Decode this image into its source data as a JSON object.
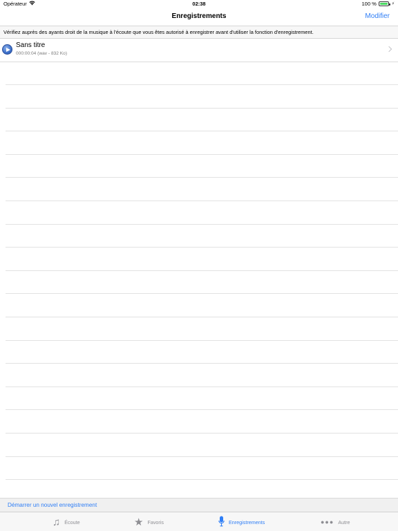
{
  "status_bar": {
    "carrier": "Opérateur",
    "wifi_icon": "wifi-icon",
    "time": "02:38",
    "battery": "100 %",
    "battery_icon": "battery-icon"
  },
  "nav": {
    "title": "Enregistrements",
    "edit_label": "Modifier"
  },
  "notice": "Vérifiez auprès des ayants droit de la musique à l'écoute que vous êtes autorisé à enregistrer avant d'utiliser la fonction d'enregistrement.",
  "recordings": [
    {
      "title": "Sans titre",
      "details": "000:00:04 (wav - 832 Ko)"
    }
  ],
  "footer": {
    "new_recording_label": "Démarrer un nouvel enregistrement"
  },
  "tabs": [
    {
      "label": "Écoute",
      "icon": "music-note-icon"
    },
    {
      "label": "Favoris",
      "icon": "star-icon"
    },
    {
      "label": "Enregistrements",
      "icon": "microphone-icon",
      "active": true
    },
    {
      "label": "Autre",
      "icon": "more-dots-icon"
    }
  ],
  "colors": {
    "accent": "#2f7ef6",
    "inactive": "#8e8e93"
  }
}
